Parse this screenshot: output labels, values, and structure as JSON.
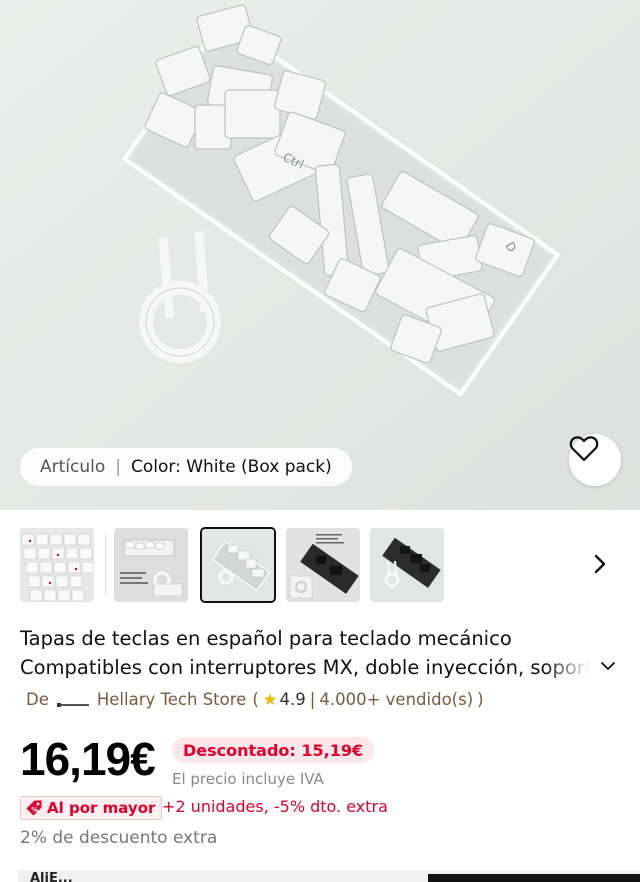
{
  "gallery": {
    "variant_label": "Artículo",
    "variant_separator": "|",
    "variant_value": "Color: White (Box pack)",
    "favorite_icon": "heart-outline-icon",
    "next_icon": "chevron-right-icon",
    "thumbnail_count": 5,
    "selected_thumbnail": 3
  },
  "product": {
    "title_line1": "Tapas de teclas en español para teclado mecánico",
    "title_line2": "Compatibles con interruptores MX, doble inyección, soporte",
    "expand_icon": "chevron-down-icon"
  },
  "store": {
    "prefix": "De",
    "name": "Hellary Tech Store",
    "open_paren": "(",
    "rating": "4.9",
    "divider": "|",
    "sold": "4.000+ vendido(s)",
    "close_paren": ")"
  },
  "pricing": {
    "price": "16,19€",
    "discount_badge": "Descontado: 15,19€",
    "vat_note": "El precio incluye IVA",
    "wholesale_tag": "Al por mayor",
    "wholesale_text": "+2 unidades, -5% dto. extra",
    "extra_discount": "2% de descuento extra"
  },
  "bottom_bar": {
    "left_text": "AliE..."
  },
  "colors": {
    "accent_red": "#e4002b",
    "badge_bg": "#fde7ea",
    "store_brown": "#7a5a3a",
    "star_yellow": "#f5b800"
  }
}
